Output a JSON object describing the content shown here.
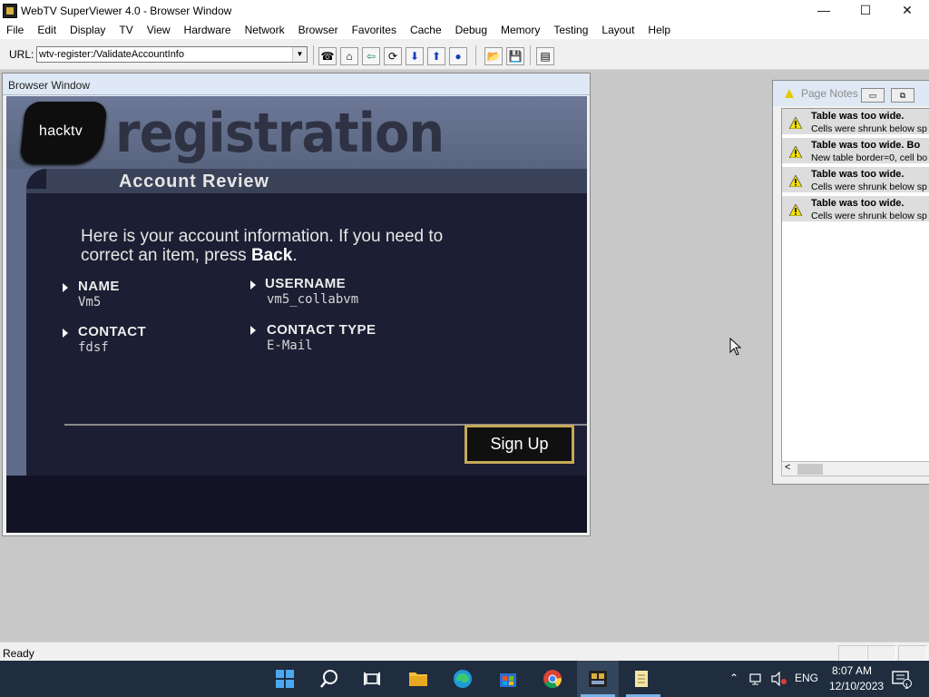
{
  "app": {
    "title": "WebTV SuperViewer 4.0 - Browser Window",
    "controls": {
      "minimize": "—",
      "maximize": "☐",
      "close": "✕"
    }
  },
  "menu": [
    "File",
    "Edit",
    "Display",
    "TV",
    "View",
    "Hardware",
    "Network",
    "Browser",
    "Favorites",
    "Cache",
    "Debug",
    "Memory",
    "Testing",
    "Layout",
    "Help"
  ],
  "toolbar": {
    "url_label": "URL:",
    "url_value": "wtv-register:/ValidateAccountInfo",
    "buttons": [
      "connect-icon",
      "home-icon",
      "back-icon",
      "reload-icon",
      "scroll-down-icon",
      "scroll-up-icon",
      "stop-icon",
      "open-icon",
      "save-icon",
      "page-notes-icon"
    ]
  },
  "browser_window": {
    "title": "Browser Window",
    "logo_text": "hacktv",
    "page_title": "registration",
    "section": "Account Review",
    "intro_before": "Here is your account information. If you need to correct an item, press ",
    "intro_bold": "Back",
    "intro_after": ".",
    "fields": [
      {
        "label": "NAME",
        "value": "Vm5"
      },
      {
        "label": "USERNAME",
        "value": "vm5_collabvm"
      },
      {
        "label": "CONTACT",
        "value": "fdsf"
      },
      {
        "label": "CONTACT TYPE",
        "value": "E-Mail"
      }
    ],
    "button": "Sign Up"
  },
  "page_notes": {
    "title": "Page Notes",
    "notes": [
      {
        "head": "Table was too wide.",
        "detail": "Cells were shrunk below sp"
      },
      {
        "head": "Table was too wide. Bo",
        "detail": "New table border=0, cell bo"
      },
      {
        "head": "Table was too wide.",
        "detail": "Cells were shrunk below sp"
      },
      {
        "head": "Table was too wide.",
        "detail": "Cells were shrunk below sp"
      }
    ]
  },
  "status": {
    "text": "Ready"
  },
  "taskbar": {
    "ime": "ENG",
    "time": "8:07 AM",
    "date": "12/10/2023",
    "notification_count": "1"
  }
}
